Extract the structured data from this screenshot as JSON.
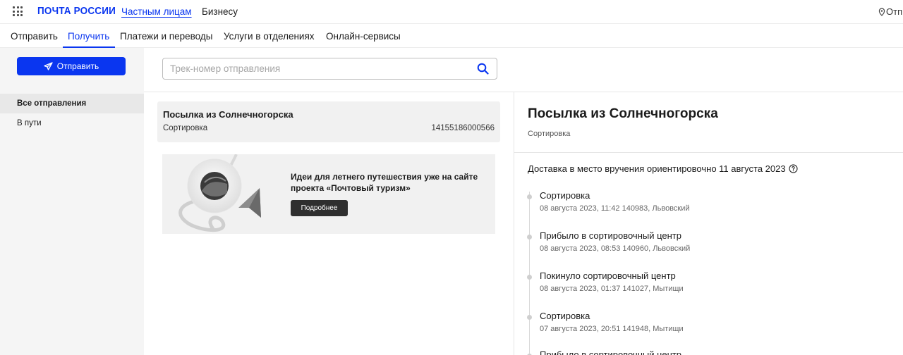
{
  "header": {
    "logo": "ПОЧТА РОССИИ",
    "audiences": [
      "Частным лицам",
      "Бизнесу"
    ],
    "location": "Отп"
  },
  "nav": {
    "items": [
      "Отправить",
      "Получить",
      "Платежи и переводы",
      "Услуги в отделениях",
      "Онлайн-сервисы"
    ],
    "active": "Получить"
  },
  "sidebar": {
    "send_button": "Отправить",
    "items": [
      "Все отправления",
      "В пути"
    ],
    "active": "Все отправления"
  },
  "search": {
    "placeholder": "Трек-номер отправления",
    "value": ""
  },
  "parcels": [
    {
      "title": "Посылка из Солнечногорска",
      "status": "Сортировка",
      "track": "14155186000566"
    }
  ],
  "promo": {
    "text": "Идеи для летнего путешествия уже на сайте проекта «Почтовый туризм»",
    "button": "Подробнее"
  },
  "details": {
    "title": "Посылка из Солнечногорска",
    "status": "Сортировка",
    "eta": "Доставка в место вручения ориентировочно 11 августа 2023",
    "events": [
      {
        "name": "Сортировка",
        "meta": "08 августа 2023, 11:42 140983, Львовский"
      },
      {
        "name": "Прибыло в сортировочный центр",
        "meta": "08 августа 2023, 08:53 140960, Львовский"
      },
      {
        "name": "Покинуло сортировочный центр",
        "meta": "08 августа 2023, 01:37 141027, Мытищи"
      },
      {
        "name": "Сортировка",
        "meta": "07 августа 2023, 20:51 141948, Мытищи"
      },
      {
        "name": "Прибыло в сортировочный центр",
        "meta": ""
      }
    ]
  },
  "colors": {
    "accent": "#0a36f0",
    "sidebar_bg": "#f5f5f5",
    "card_bg": "#f1f1f1"
  }
}
